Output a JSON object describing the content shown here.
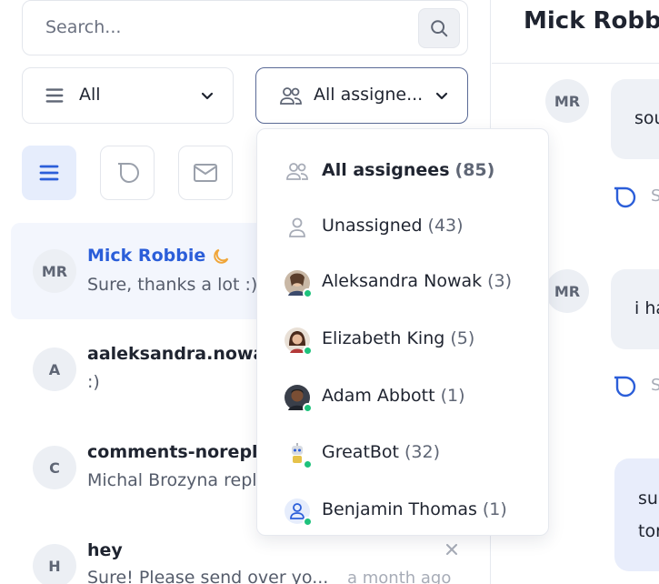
{
  "search": {
    "placeholder": "Search..."
  },
  "filters": {
    "status": {
      "label": "All"
    },
    "assignee": {
      "label": "All assigne..."
    }
  },
  "dropdown": {
    "items": [
      {
        "label": "All assignees",
        "count": "(85)",
        "icon": "people-icon",
        "bold": true
      },
      {
        "label": "Unassigned",
        "count": "(43)",
        "icon": "person-icon"
      },
      {
        "label": "Aleksandra Nowak",
        "count": "(3)",
        "icon": "avatar-photo"
      },
      {
        "label": "Elizabeth King",
        "count": "(5)",
        "icon": "avatar-photo"
      },
      {
        "label": "Adam Abbott",
        "count": "(1)",
        "icon": "avatar-photo"
      },
      {
        "label": "GreatBot",
        "count": "(32)",
        "icon": "bot-icon"
      },
      {
        "label": "Benjamin Thomas",
        "count": "(1)",
        "icon": "person-icon"
      }
    ]
  },
  "conversations": [
    {
      "initials": "MR",
      "name": "Mick Robbie",
      "preview": "Sure, thanks a lot :)",
      "time": ""
    },
    {
      "initials": "A",
      "name": "aaleksandra.nowak",
      "preview": ":)",
      "time": ""
    },
    {
      "initials": "C",
      "name": "comments-norepl",
      "preview": "Michal Brozyna repl",
      "time": ""
    },
    {
      "initials": "H",
      "name": "hey",
      "preview": "Sure! Please send over yo...",
      "time": "a month ago"
    }
  ],
  "chat": {
    "title": "Mick Robbie",
    "messages": [
      {
        "initials": "MR",
        "text": "sou",
        "status": "S"
      },
      {
        "initials": "MR",
        "text": "i ha",
        "status": "S"
      },
      {
        "text_line1": "su",
        "text_line2": "tor"
      }
    ]
  },
  "colors": {
    "accent": "#2b5ed9",
    "online": "#1ec27c",
    "pending": "#f0a63a"
  }
}
